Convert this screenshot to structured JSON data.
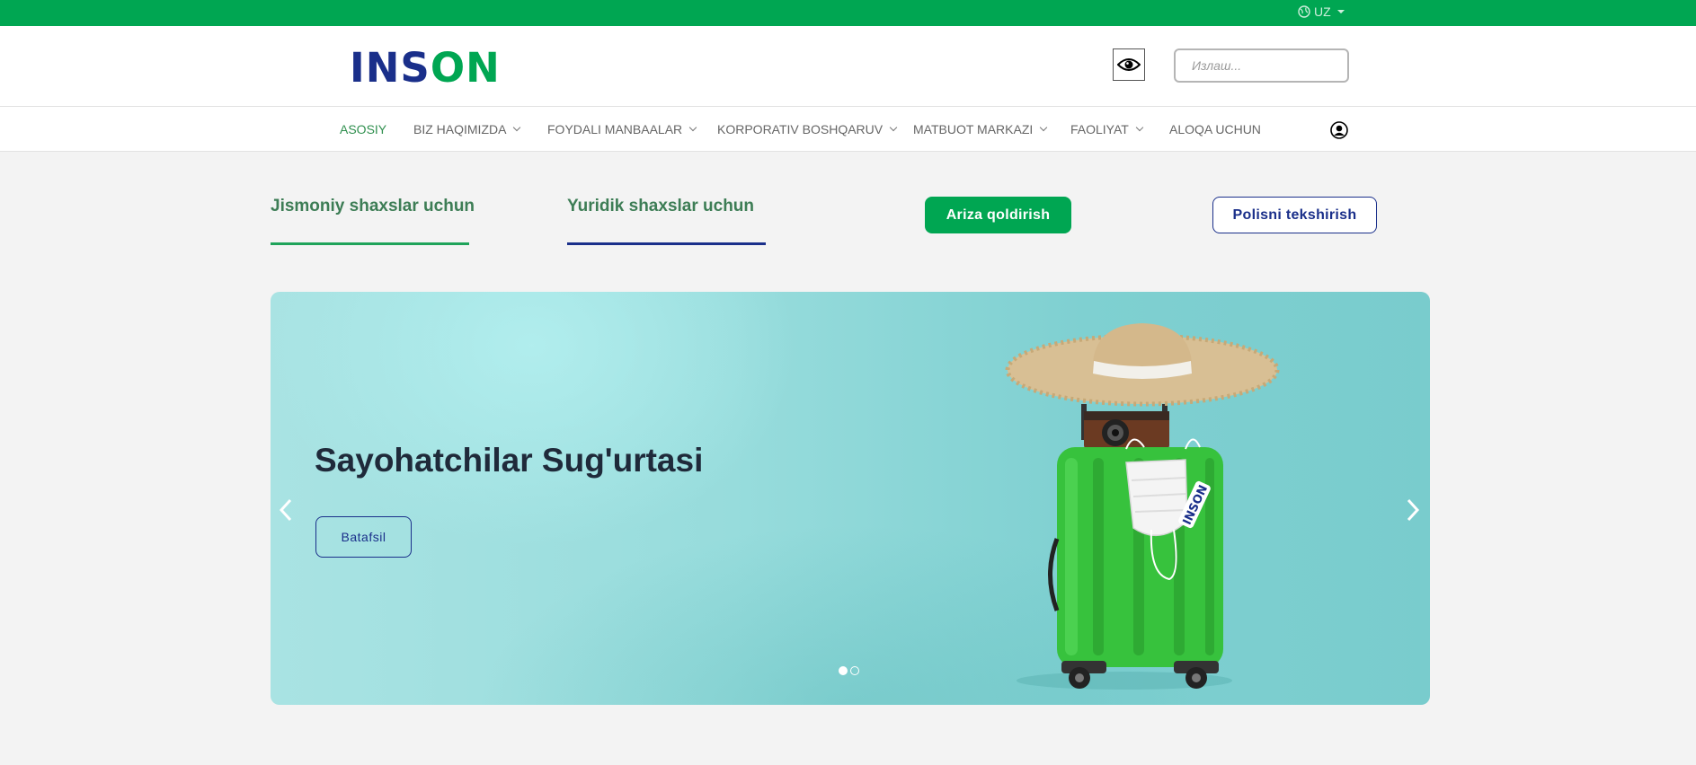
{
  "topbar": {
    "lang_label": "UZ"
  },
  "header": {
    "logo_part1": "INS",
    "logo_part2": "ON",
    "search_placeholder": "Излаш..."
  },
  "nav": {
    "items": [
      {
        "label": "ASOSIY"
      },
      {
        "label": "BIZ HAQIMIZDA"
      },
      {
        "label": "FOYDALI MANBAALAR"
      },
      {
        "label": "KORPORATIV BOSHQARUV"
      },
      {
        "label": "MATBUOT MARKAZI"
      },
      {
        "label": "FAOLIYAT"
      },
      {
        "label": "ALOQA UCHUN"
      }
    ]
  },
  "tabs": {
    "individual": "Jismoniy shaxslar uchun",
    "legal": "Yuridik shaxslar uchun"
  },
  "actions": {
    "apply": "Ariza qoldirish",
    "check_policy": "Polisni tekshirish"
  },
  "banner": {
    "title": "Sayohatchilar Sug'urtasi",
    "more": "Batafsil",
    "slide_count": 2,
    "active_slide": 1,
    "sticker_text": "INSON"
  },
  "colors": {
    "brand_green": "#00a652",
    "brand_blue": "#1a2f8a",
    "banner_teal": "#8fd8d8"
  }
}
